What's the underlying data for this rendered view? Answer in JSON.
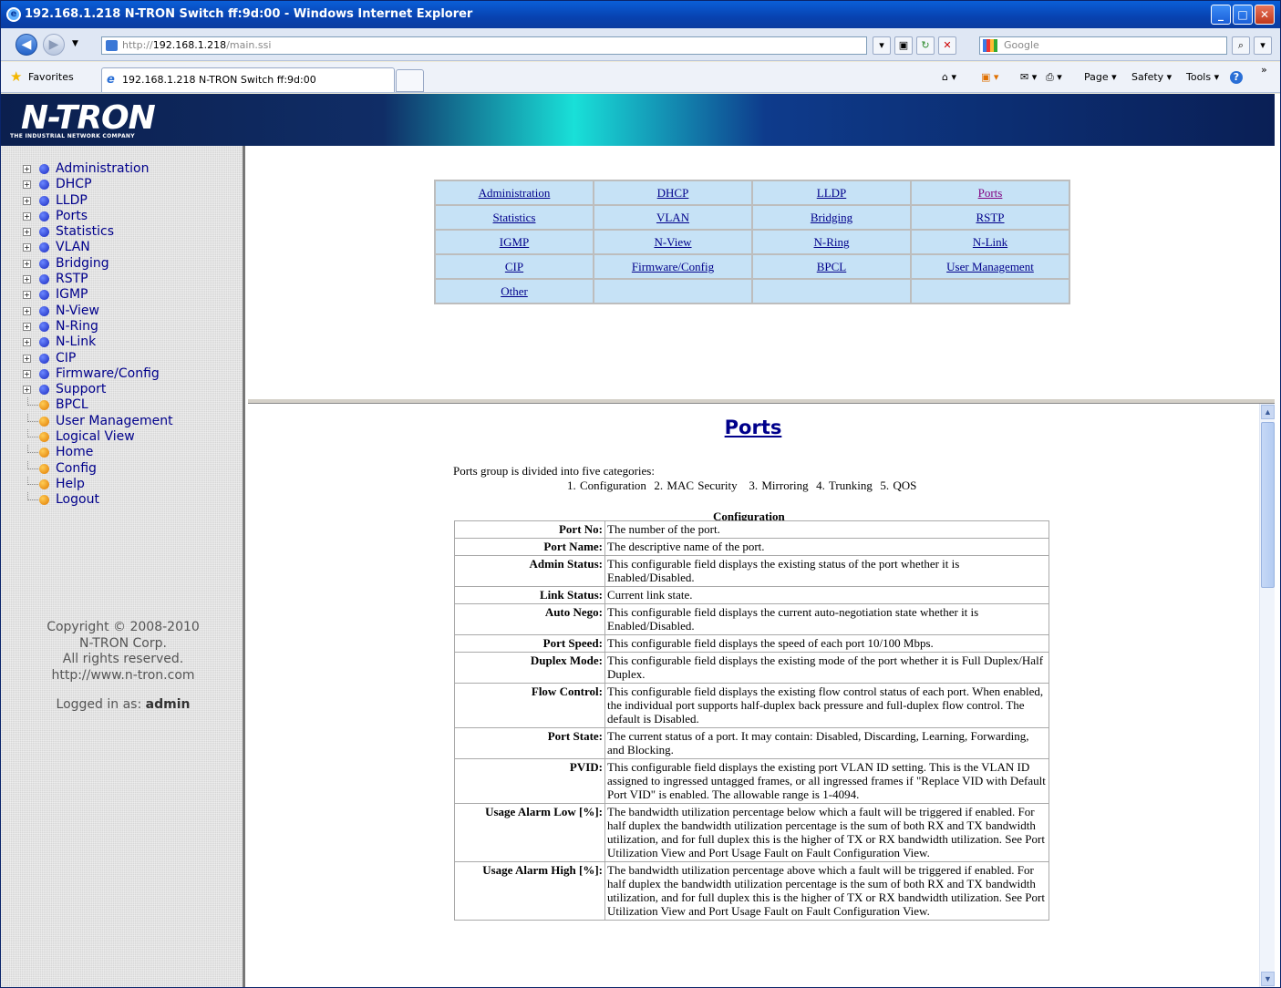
{
  "window": {
    "title": "192.168.1.218 N-TRON Switch ff:9d:00 - Windows Internet Explorer"
  },
  "address": {
    "prefix": "http://",
    "host": "192.168.1.218",
    "path": "/main.ssi"
  },
  "search": {
    "placeholder": "Google"
  },
  "favorites": {
    "label": "Favorites",
    "tab_title": "192.168.1.218 N-TRON Switch ff:9d:00"
  },
  "commandbar": {
    "page": "Page ▾",
    "safety": "Safety ▾",
    "tools": "Tools ▾",
    "help": "?"
  },
  "banner": {
    "logo": "N-TRON",
    "tagline": "THE INDUSTRIAL NETWORK COMPANY"
  },
  "sidebar": {
    "items": [
      {
        "label": "Administration",
        "type": "folder"
      },
      {
        "label": "DHCP",
        "type": "folder"
      },
      {
        "label": "LLDP",
        "type": "folder"
      },
      {
        "label": "Ports",
        "type": "folder"
      },
      {
        "label": "Statistics",
        "type": "folder"
      },
      {
        "label": "VLAN",
        "type": "folder"
      },
      {
        "label": "Bridging",
        "type": "folder"
      },
      {
        "label": "RSTP",
        "type": "folder"
      },
      {
        "label": "IGMP",
        "type": "folder"
      },
      {
        "label": "N-View",
        "type": "folder"
      },
      {
        "label": "N-Ring",
        "type": "folder"
      },
      {
        "label": "N-Link",
        "type": "folder"
      },
      {
        "label": "CIP",
        "type": "folder"
      },
      {
        "label": "Firmware/Config",
        "type": "folder"
      },
      {
        "label": "Support",
        "type": "folder"
      },
      {
        "label": "BPCL",
        "type": "leaf"
      },
      {
        "label": "User Management",
        "type": "leaf"
      },
      {
        "label": "Logical View",
        "type": "leaf"
      },
      {
        "label": "Home",
        "type": "leaf"
      },
      {
        "label": "Config",
        "type": "leaf"
      },
      {
        "label": "Help",
        "type": "leaf"
      },
      {
        "label": "Logout",
        "type": "leaf"
      }
    ],
    "copyright_line1": "Copyright © 2008-2010",
    "copyright_line2": "N-TRON Corp.",
    "copyright_line3": "All rights reserved.",
    "copyright_line4": "http://www.n-tron.com",
    "logged_prefix": "Logged in as: ",
    "logged_user": "admin"
  },
  "menu": {
    "rows": [
      [
        "Administration",
        "DHCP",
        "LLDP",
        "Ports"
      ],
      [
        "Statistics",
        "VLAN",
        "Bridging",
        "RSTP"
      ],
      [
        "IGMP",
        "N-View",
        "N-Ring",
        "N-Link"
      ],
      [
        "CIP",
        "Firmware/Config",
        "BPCL",
        "User Management"
      ],
      [
        "Other",
        "",
        "",
        ""
      ]
    ],
    "visited": "Ports"
  },
  "help": {
    "title": "Ports",
    "intro": "Ports group is divided into five categories:",
    "categories": "1. Configuration  2. MAC Security   3. Mirroring  4. Trunking  5. QOS",
    "section_title": "Configuration",
    "rows": [
      {
        "k": "Port No:",
        "v": "The number of the port."
      },
      {
        "k": "Port Name:",
        "v": "The descriptive name of the port."
      },
      {
        "k": "Admin Status:",
        "v": "This configurable field displays the existing status of the port whether it is Enabled/Disabled."
      },
      {
        "k": "Link Status:",
        "v": "Current link state."
      },
      {
        "k": "Auto Nego:",
        "v": "This configurable field displays the current auto-negotiation state whether it is Enabled/Disabled."
      },
      {
        "k": "Port Speed:",
        "v": "This configurable field displays the speed of each port 10/100 Mbps."
      },
      {
        "k": "Duplex Mode:",
        "v": "This configurable field displays the existing mode of the port whether it is Full Duplex/Half Duplex."
      },
      {
        "k": "Flow Control:",
        "v": "This configurable field displays the existing flow control status of each port. When enabled, the individual port supports half-duplex back pressure and full-duplex flow control. The default is Disabled."
      },
      {
        "k": "Port State:",
        "v": "The current status of a port. It may contain: Disabled, Discarding, Learning, Forwarding, and Blocking."
      },
      {
        "k": "PVID:",
        "v": "This configurable field displays the existing port VLAN ID setting. This is the VLAN ID assigned to ingressed untagged frames, or all ingressed frames if \"Replace VID with Default Port VID\" is enabled. The allowable range is 1-4094."
      },
      {
        "k": "Usage Alarm Low [%]:",
        "v": "The bandwidth utilization percentage below which a fault will be triggered if enabled. For half duplex the bandwidth utilization percentage is the sum of both RX and TX bandwidth utilization, and for full duplex this is the higher of TX or RX bandwidth utilization. See Port Utilization View and Port Usage Fault on Fault Configuration View."
      },
      {
        "k": "Usage Alarm High [%]:",
        "v": "The bandwidth utilization percentage above which a fault will be triggered if enabled. For half duplex the bandwidth utilization percentage is the sum of both RX and TX bandwidth utilization, and for full duplex this is the higher of TX or RX bandwidth utilization. See Port Utilization View and Port Usage Fault on Fault Configuration View."
      }
    ]
  }
}
